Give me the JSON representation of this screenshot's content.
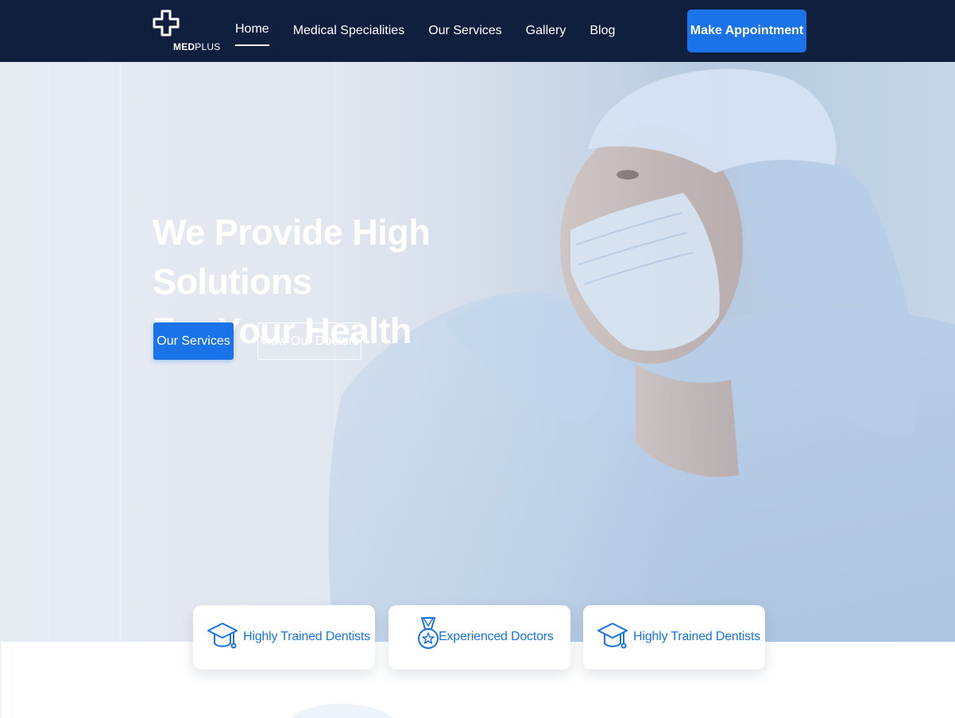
{
  "brand": {
    "logo_bold": "MED",
    "logo_light": "PLUS"
  },
  "nav": {
    "items": [
      {
        "label": "Home",
        "active": true
      },
      {
        "label": "Medical Specialities",
        "active": false
      },
      {
        "label": "Our Services",
        "active": false
      },
      {
        "label": "Gallery",
        "active": false
      },
      {
        "label": "Blog",
        "active": false
      }
    ],
    "cta_label": "Make Appointment"
  },
  "hero": {
    "title_line1": "We Provide High Solutions",
    "title_line2": "For Your Health",
    "primary_button": "Our Services",
    "secondary_button": "View Our Doctors"
  },
  "features": [
    {
      "label": "Highly Trained Dentists",
      "icon": "graduation-cap-icon"
    },
    {
      "label": "Experienced Doctors",
      "icon": "medal-icon"
    },
    {
      "label": "Highly Trained Dentists",
      "icon": "graduation-cap-icon"
    }
  ],
  "colors": {
    "navbar": "#0f1f3d",
    "accent": "#1a73e8",
    "hero_bg": "#cbd7e6"
  }
}
